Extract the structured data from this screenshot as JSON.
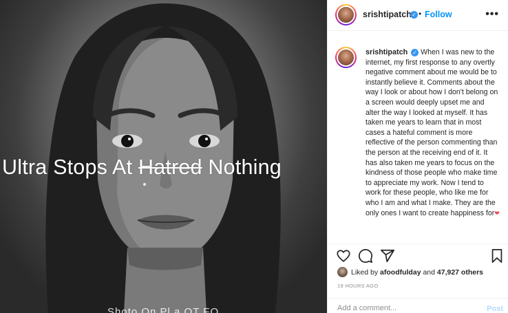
{
  "post": {
    "overlay": {
      "word1": "Ultra Stops At",
      "struck": "Hatred",
      "word2": "Nothing",
      "bottom": "Shoto On Pl a OT FO"
    }
  },
  "header": {
    "username": "srishtipatch",
    "verified_symbol": "✓",
    "separator": "•",
    "follow_label": "Follow",
    "more_icon": "more-horizontal-icon",
    "more_symbol": "•••"
  },
  "caption": {
    "username": "srishtipatch",
    "verified_symbol": "✓",
    "text": "When I was new to the internet, my first response to any overtly negative comment about me would be to instantly believe it. Comments about the way I look or about how I don't belong on a screen would deeply upset me and alter the way I looked at myself. It has taken me years to learn that in most cases a hateful comment is more reflective of the person commenting than the person at the receiving end of it. It has also taken me years to focus on the kindness of those people who make time to appreciate my work. Now I tend to work for these people, who like me for who I am and what I make. They are the only ones I want to create happiness for",
    "emoji": "❤"
  },
  "actions": {
    "icons": [
      "heart-icon",
      "comment-icon",
      "share-icon",
      "bookmark-icon"
    ]
  },
  "likes": {
    "prefix": "Liked by ",
    "user": "afoodfulday",
    "middle": " and ",
    "count": "47,927 others"
  },
  "timestamp": "19 HOURS AGO",
  "comment": {
    "placeholder": "Add a comment...",
    "post_label": "Post"
  },
  "colors": {
    "link_blue": "#0095f6",
    "verified_blue": "#3897f0",
    "muted": "#8e8e8e",
    "post_disabled": "#b3dbff"
  }
}
